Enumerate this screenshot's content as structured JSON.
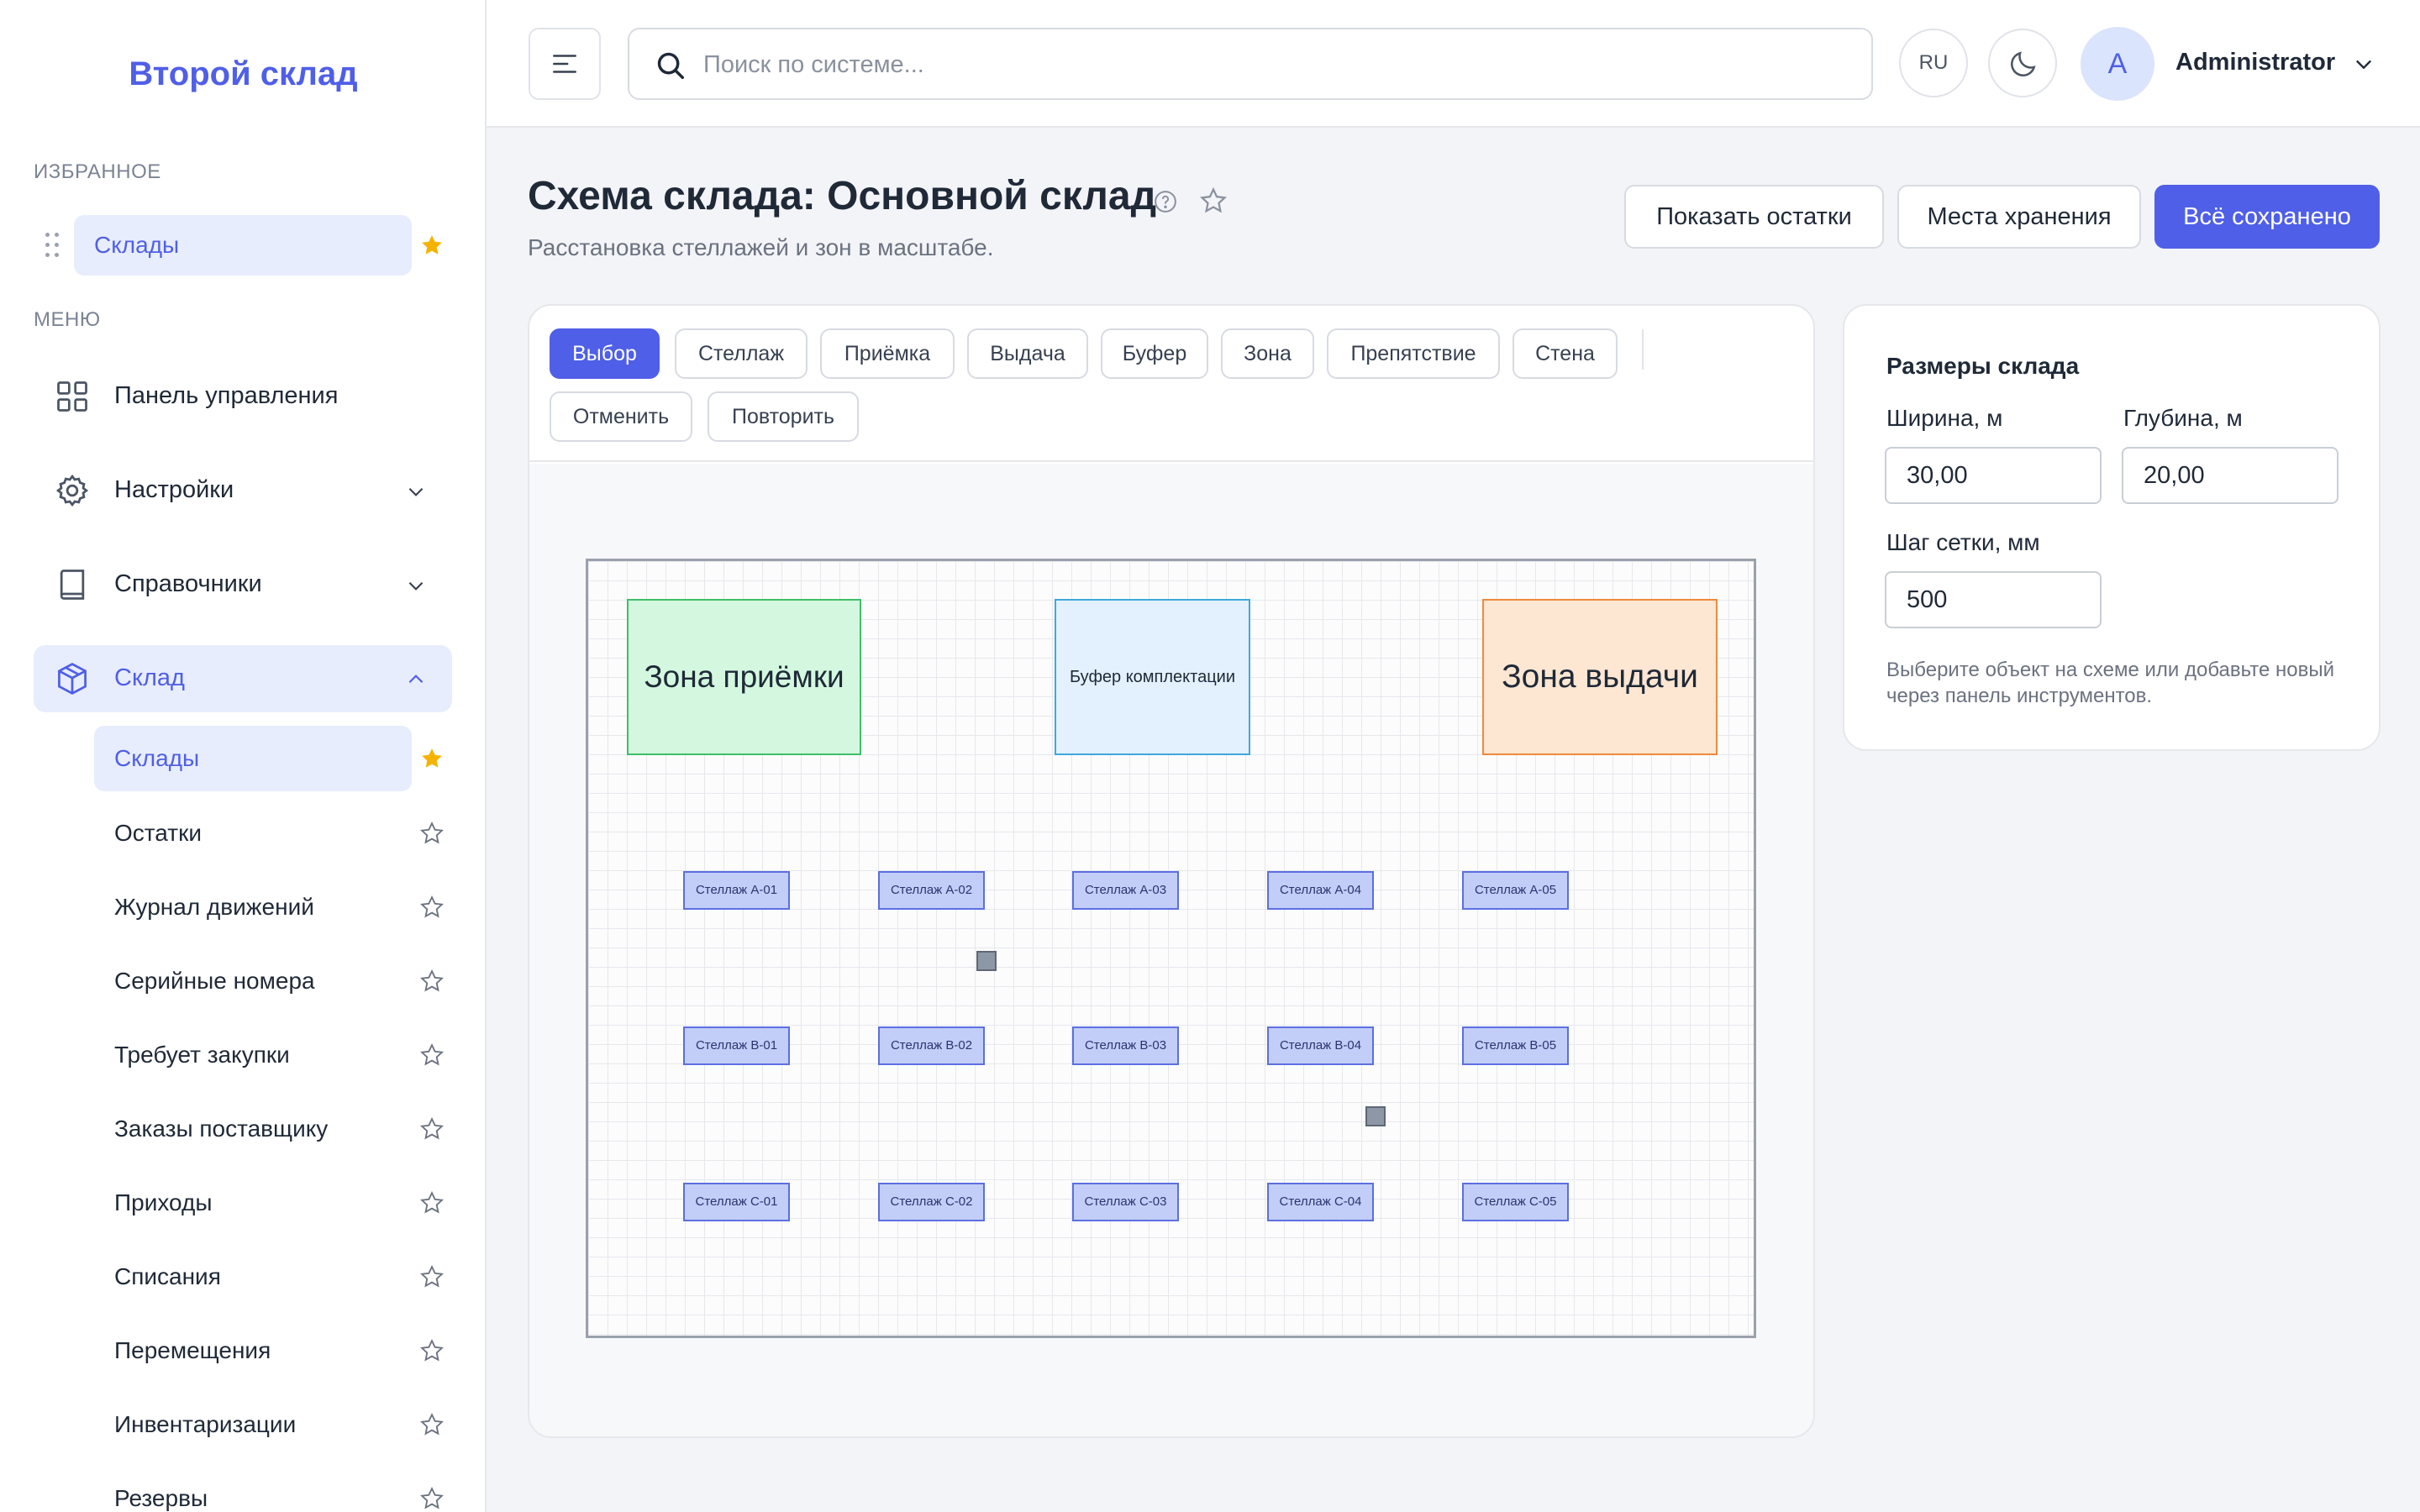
{
  "sidebar": {
    "brand": "Второй склад",
    "favorites_label": "ИЗБРАННОЕ",
    "favorites": [
      {
        "label": "Склады",
        "starred": true
      }
    ],
    "menu_label": "МЕНЮ",
    "menu": [
      {
        "label": "Панель управления",
        "icon": "dashboard-icon"
      },
      {
        "label": "Настройки",
        "icon": "gear-icon",
        "expandable": true
      },
      {
        "label": "Справочники",
        "icon": "book-icon",
        "expandable": true
      },
      {
        "label": "Склад",
        "icon": "box-icon",
        "expanded": true,
        "active": true
      }
    ],
    "warehouse_items": [
      {
        "label": "Склады",
        "starred": true,
        "active": true
      },
      {
        "label": "Остатки",
        "starred": false
      },
      {
        "label": "Журнал движений",
        "starred": false
      },
      {
        "label": "Серийные номера",
        "starred": false
      },
      {
        "label": "Требует закупки",
        "starred": false
      },
      {
        "label": "Заказы поставщику",
        "starred": false
      },
      {
        "label": "Приходы",
        "starred": false
      },
      {
        "label": "Списания",
        "starred": false
      },
      {
        "label": "Перемещения",
        "starred": false
      },
      {
        "label": "Инвентаризации",
        "starred": false
      },
      {
        "label": "Резервы",
        "starred": false
      }
    ]
  },
  "header": {
    "search_placeholder": "Поиск по системе...",
    "language": "RU",
    "avatar_letter": "A",
    "user_name": "Administrator"
  },
  "page": {
    "title": "Схема склада: Основной склад",
    "subtitle": "Расстановка стеллажей и зон в масштабе.",
    "buttons": {
      "show_stock": "Показать остатки",
      "storage_places": "Места хранения",
      "saved": "Всё сохранено"
    }
  },
  "toolbar": {
    "tools": [
      "Выбор",
      "Стеллаж",
      "Приёмка",
      "Выдача",
      "Буфер",
      "Зона",
      "Препятствие",
      "Стена"
    ],
    "active_tool": "Выбор",
    "undo": "Отменить",
    "redo": "Повторить"
  },
  "plan": {
    "zones": {
      "receiving": "Зона приёмки",
      "buffer": "Буфер комплектации",
      "shipping": "Зона выдачи"
    },
    "racks": [
      [
        "Стеллаж A-01",
        "Стеллаж A-02",
        "Стеллаж A-03",
        "Стеллаж A-04",
        "Стеллаж A-05"
      ],
      [
        "Стеллаж B-01",
        "Стеллаж B-02",
        "Стеллаж B-03",
        "Стеллаж B-04",
        "Стеллаж B-05"
      ],
      [
        "Стеллаж C-01",
        "Стеллаж C-02",
        "Стеллаж C-03",
        "Стеллаж C-04",
        "Стеллаж C-05"
      ]
    ],
    "obstacle_count": 2
  },
  "panel": {
    "title": "Размеры склада",
    "width_label": "Ширина, м",
    "width_value": "30,00",
    "depth_label": "Глубина, м",
    "depth_value": "20,00",
    "grid_label": "Шаг сетки, мм",
    "grid_value": "500",
    "hint": "Выберите объект на схеме или добавьте новый через панель инструментов."
  },
  "colors": {
    "accent": "#4f5fe8",
    "star_active": "#f5b301",
    "zone_receiving": "#d3f8df",
    "zone_buffer": "#e2f1fd",
    "zone_shipping": "#fde6d2",
    "rack": "#c3cef8"
  }
}
